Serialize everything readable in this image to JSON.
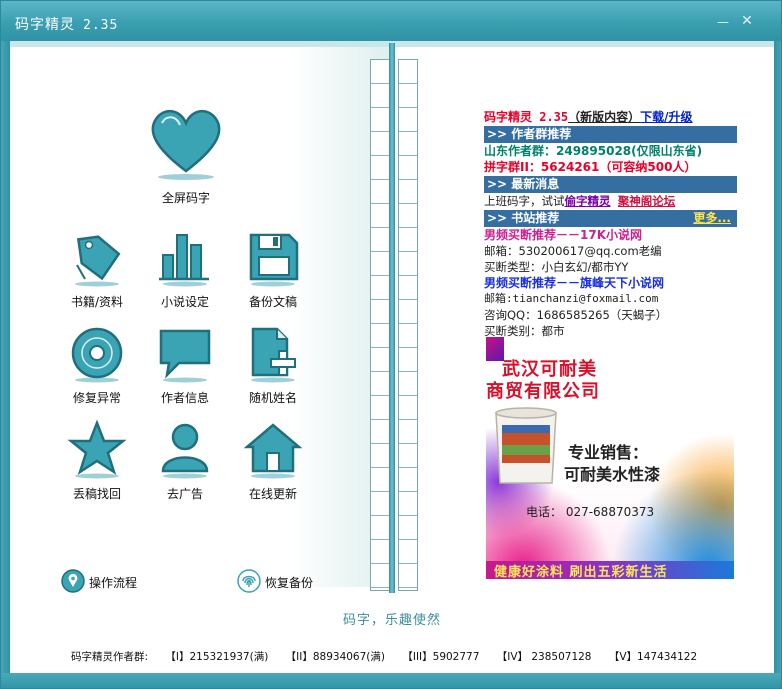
{
  "window": {
    "title": "码字精灵",
    "version": "2.35",
    "minimize_glyph": "—",
    "close_glyph": "✕"
  },
  "heart_tile": {
    "label": "全屏码字",
    "icon": "heart-icon"
  },
  "grid_tiles": [
    {
      "label": "书籍/资料",
      "icon": "price-tag-icon"
    },
    {
      "label": "小说设定",
      "icon": "bar-chart-icon"
    },
    {
      "label": "备份文稿",
      "icon": "floppy-disk-icon"
    },
    {
      "label": "修复异常",
      "icon": "disc-icon"
    },
    {
      "label": "作者信息",
      "icon": "speech-bubble-icon"
    },
    {
      "label": "随机姓名",
      "icon": "document-plus-icon"
    },
    {
      "label": "丢稿找回",
      "icon": "star-icon"
    },
    {
      "label": "去广告",
      "icon": "user-icon"
    },
    {
      "label": "在线更新",
      "icon": "house-icon"
    }
  ],
  "links": {
    "workflow": "操作流程",
    "restore_backup": "恢复备份"
  },
  "slogan": "码字，乐趣使然",
  "footer": {
    "prefix": "码字精灵作者群:",
    "groups": [
      "【I】215321937(满)",
      "【II】88934067(满)",
      "【III】5902777",
      "【IV】 238507128",
      "【V】147434122"
    ]
  },
  "panel": {
    "version_line": "码字精灵 2.35",
    "version_new": "（新版内容）",
    "download": "下载/升级",
    "author_groups_header": ">> 作者群推荐",
    "shandong_group": "山东作者群：249895028(仅限山东省)",
    "pinzi_group": "拼字群II：5624261（可容纳500人）",
    "news_header": ">> 最新消息",
    "news_text": "上班码字，试试",
    "news_link1": "偷字精灵",
    "news_link2": "聚神阁论坛",
    "books_header": ">> 书站推荐",
    "more": "更多...",
    "rec1_title": "男频买断推荐－－17K小说网",
    "rec1_mail": "邮箱：530200617@qq.com老编",
    "rec1_type": "买断类型：小白玄幻/都市YY",
    "rec2_title": "男频买断推荐－－旗峰天下小说网",
    "rec2_mail": "邮箱:tianchanzi@foxmail.com",
    "rec2_qq": "咨询QQ：1686585265（天蝎子）",
    "rec2_type": "买断类别：都市"
  },
  "ad": {
    "company_line1": "武汉可耐美",
    "company_line2": "商贸有限公司",
    "sales_line1": "专业销售：",
    "sales_line2": "可耐美水性漆",
    "phone": "电话：  027-68870373",
    "band": "健康好涂料  刷出五彩新生活"
  },
  "colors": {
    "title_bar": "#3a9fb1",
    "icon_teal": "#3aa3b4",
    "header_blue": "#356ea0"
  }
}
